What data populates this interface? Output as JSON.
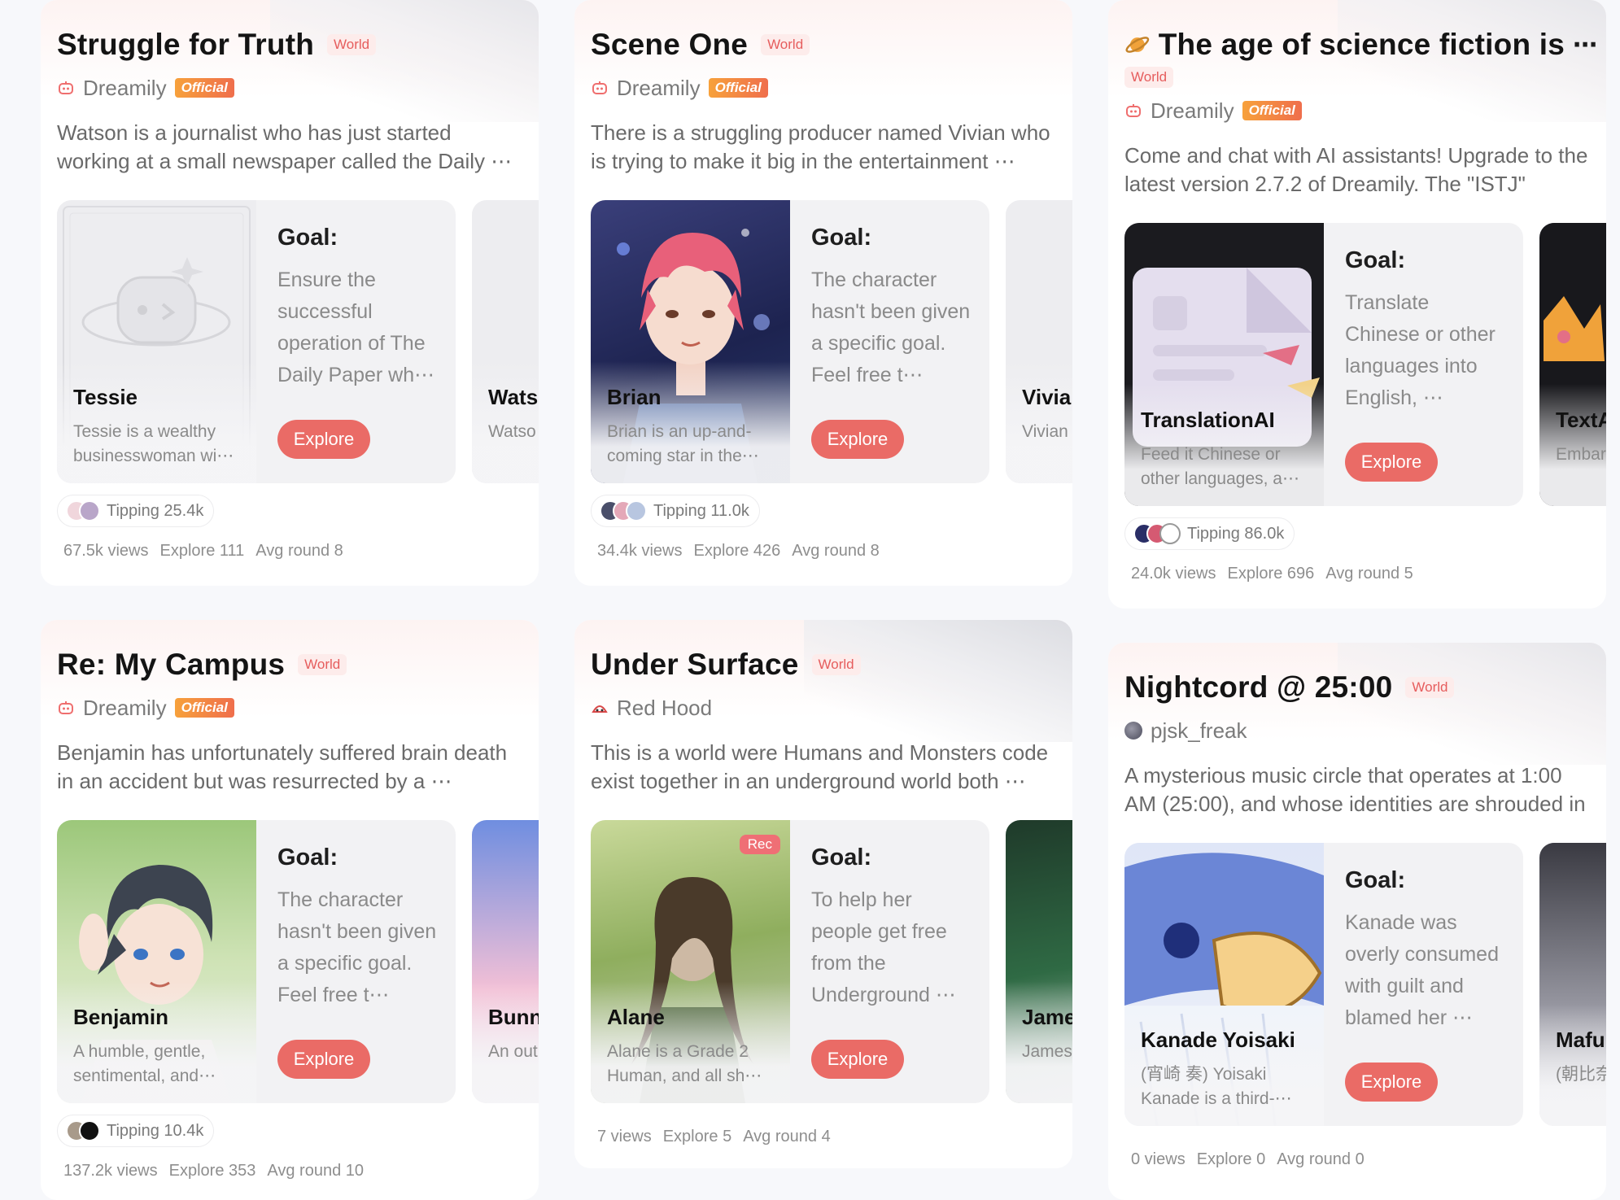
{
  "cards": [
    {
      "title": "Struggle for Truth",
      "tag": "World",
      "author": "Dreamily",
      "official": "Official",
      "description": "Watson is a journalist who has just started working at a small newspaper called the Daily ⋯",
      "character": {
        "name": "Tessie",
        "desc": "Tessie is a wealthy businesswoman wi⋯",
        "goal_label": "Goal:",
        "goal": "Ensure the successful operation of The Daily Paper wh⋯",
        "button": "Explore"
      },
      "peek": {
        "name": "Wats",
        "desc": "Watso at a sn"
      },
      "tipping": "Tipping 25.4k",
      "views": "67.5k views",
      "explore": "Explore 111",
      "avg_round": "Avg round 8"
    },
    {
      "title": "Scene One",
      "tag": "World",
      "author": "Dreamily",
      "official": "Official",
      "description": "There is a struggling producer named Vivian who is trying to make it big in the entertainment ⋯",
      "character": {
        "name": "Brian",
        "desc": "Brian is an up-and-coming star in the⋯",
        "goal_label": "Goal:",
        "goal": "The character hasn't been given a specific goal. Feel free t⋯",
        "button": "Explore"
      },
      "peek": {
        "name": "Vivia",
        "desc": "Vivian at the"
      },
      "tipping": "Tipping 11.0k",
      "views": "34.4k views",
      "explore": "Explore 426",
      "avg_round": "Avg round 8"
    },
    {
      "title": "The age of science fiction is",
      "more": "⋯",
      "tag": "World",
      "author": "Dreamily",
      "official": "Official",
      "description": "Come and chat with AI assistants! Upgrade to the latest version 2.7.2 of Dreamily. The \"ISTJ\" mode⋯",
      "character": {
        "name": "TranslationAI",
        "desc": "Feed it Chinese or other languages, a⋯",
        "goal_label": "Goal:",
        "goal": "Translate Chinese or other languages into English, ⋯",
        "button": "Explore"
      },
      "peek": {
        "name": "TextA",
        "desc": "Embar quest"
      },
      "tipping": "Tipping 86.0k",
      "views": "24.0k views",
      "explore": "Explore 696",
      "avg_round": "Avg round 5"
    },
    {
      "title": "Re: My Campus",
      "tag": "World",
      "author": "Dreamily",
      "official": "Official",
      "description": "Benjamin has unfortunately suffered brain death in an accident but was resurrected by a ⋯",
      "character": {
        "name": "Benjamin",
        "desc": "A humble, gentle, sentimental, and⋯",
        "goal_label": "Goal:",
        "goal": "The character hasn't been given a specific goal. Feel free t⋯",
        "button": "Explore"
      },
      "peek": {
        "name": "Bunn",
        "desc": "An out lovely"
      },
      "tipping": "Tipping 10.4k",
      "views": "137.2k views",
      "explore": "Explore 353",
      "avg_round": "Avg round 10"
    },
    {
      "title": "Under Surface",
      "tag": "World",
      "author": "Red Hood",
      "description": "This is a world were Humans and Monsters code exist together in an underground world both ⋯",
      "character": {
        "name": "Alane",
        "rec": "Rec",
        "desc": "Alane is a Grade 2 Human, and all sh⋯",
        "goal_label": "Goal:",
        "goal": "To help her people get free from the Underground ⋯",
        "button": "Explore"
      },
      "peek": {
        "name": "Jame",
        "desc": "James Huma"
      },
      "views": "7 views",
      "explore": "Explore 5",
      "avg_round": "Avg round 4"
    },
    {
      "title": "Nightcord @ 25:00",
      "tag": "World",
      "author": "pjsk_freak",
      "description": "A mysterious music circle that operates at 1:00 AM (25:00), and whose identities are shrouded in ⋯",
      "character": {
        "name": "Kanade Yoisaki",
        "desc": "(宵崎 奏) Yoisaki Kanade is a third-⋯",
        "goal_label": "Goal:",
        "goal": "Kanade was overly consumed with guilt and blamed her ⋯",
        "button": "Explore"
      },
      "peek": {
        "name": "Mafu",
        "desc": "(朝比奈 Asahir"
      },
      "views": "0 views",
      "explore": "Explore 0",
      "avg_round": "Avg round 0"
    }
  ],
  "colors": {
    "accent": "#ea6b66",
    "tag_text": "#e65d5d",
    "tag_bg": "#fdeceb",
    "official_from": "#f7a13b",
    "official_to": "#ef6e4c"
  },
  "icons": {
    "dreamily": "dreamily-robot-icon",
    "redhood": "red-hood-icon",
    "pjsk": "avatar-icon",
    "planet": "planet-icon"
  }
}
